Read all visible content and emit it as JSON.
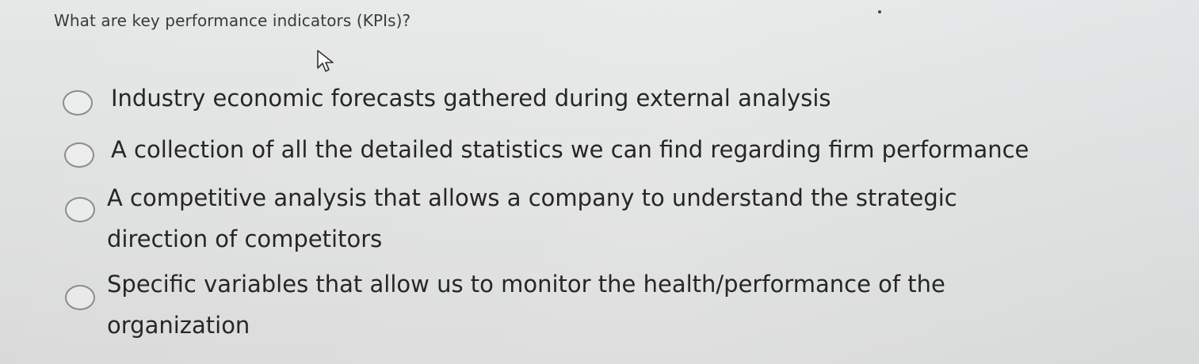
{
  "question": {
    "text": "What are key performance indicators (KPIs)?"
  },
  "options": [
    {
      "lines": [
        "Industry economic forecasts gathered during external analysis"
      ],
      "selected": false
    },
    {
      "lines": [
        "A collection of all the detailed statistics we can find regarding firm performance"
      ],
      "selected": false
    },
    {
      "lines": [
        "A competitive analysis that allows a company to understand the strategic",
        "direction of competitors"
      ],
      "selected": false
    },
    {
      "lines": [
        "Specific variables that allow us to monitor the health/performance of the",
        "organization"
      ],
      "selected": false
    }
  ],
  "cursor": {
    "icon": "mouse-pointer-icon"
  }
}
